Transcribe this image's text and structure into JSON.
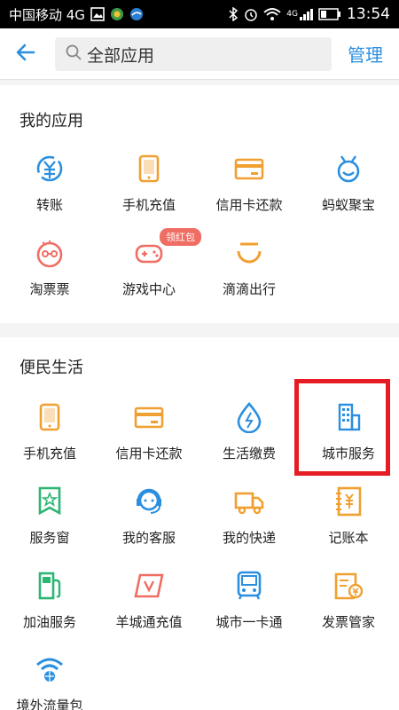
{
  "status_bar": {
    "carrier": "中国移动 4G",
    "time": "13:54",
    "network": "4G"
  },
  "header": {
    "search_text": "全部应用",
    "manage_label": "管理"
  },
  "my_apps": {
    "title": "我的应用",
    "items": [
      {
        "label": "转账",
        "icon": "transfer-icon"
      },
      {
        "label": "手机充值",
        "icon": "phone-icon"
      },
      {
        "label": "信用卡还款",
        "icon": "credit-card-icon"
      },
      {
        "label": "蚂蚁聚宝",
        "icon": "ant-fortune-icon"
      },
      {
        "label": "淘票票",
        "icon": "movie-ticket-icon"
      },
      {
        "label": "游戏中心",
        "icon": "gamepad-icon",
        "badge": "领红包"
      },
      {
        "label": "滴滴出行",
        "icon": "didi-icon"
      }
    ]
  },
  "services": {
    "title": "便民生活",
    "items": [
      {
        "label": "手机充值",
        "icon": "phone-icon"
      },
      {
        "label": "信用卡还款",
        "icon": "credit-card-icon"
      },
      {
        "label": "生活缴费",
        "icon": "utility-drop-icon"
      },
      {
        "label": "城市服务",
        "icon": "building-icon"
      },
      {
        "label": "服务窗",
        "icon": "service-window-icon"
      },
      {
        "label": "我的客服",
        "icon": "customer-service-icon"
      },
      {
        "label": "我的快递",
        "icon": "delivery-truck-icon"
      },
      {
        "label": "记账本",
        "icon": "ledger-icon"
      },
      {
        "label": "加油服务",
        "icon": "fuel-pump-icon"
      },
      {
        "label": "羊城通充值",
        "icon": "yct-card-icon"
      },
      {
        "label": "城市一卡通",
        "icon": "bus-card-icon"
      },
      {
        "label": "发票管家",
        "icon": "invoice-icon"
      },
      {
        "label": "境外流量包",
        "icon": "wifi-globe-icon"
      }
    ]
  },
  "colors": {
    "accent": "#2b8fe0",
    "orange": "#f0a030",
    "red": "#f06d63",
    "green": "#2bb673",
    "highlight": "#e51c23"
  }
}
